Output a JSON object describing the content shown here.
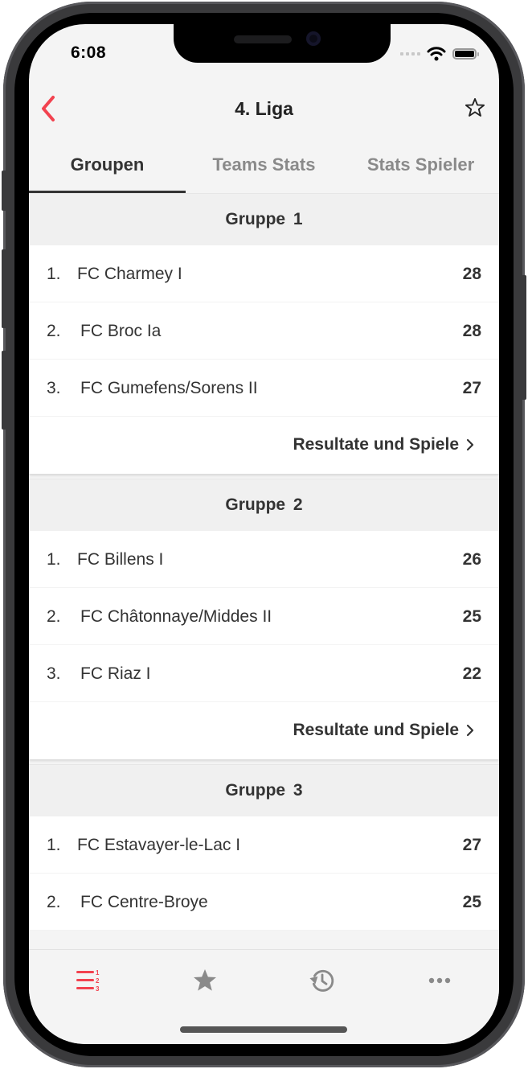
{
  "status_bar": {
    "time": "6:08"
  },
  "nav": {
    "title": "4. Liga",
    "back_icon": "chevron-left-icon",
    "favorite_icon": "star-outline-icon"
  },
  "tabs": [
    {
      "label": "Groupen",
      "active": true
    },
    {
      "label": "Teams Stats",
      "active": false
    },
    {
      "label": "Stats Spieler",
      "active": false
    }
  ],
  "groups": [
    {
      "title": "Gruppe  1",
      "rows": [
        {
          "rank": "1.",
          "team": "FC Charmey I",
          "points": "28"
        },
        {
          "rank": "2.",
          "team": "FC Broc Ia",
          "points": "28"
        },
        {
          "rank": "3.",
          "team": "FC Gumefens/Sorens II",
          "points": "27"
        }
      ],
      "results_link": "Resultate und Spiele"
    },
    {
      "title": "Gruppe  2",
      "rows": [
        {
          "rank": "1.",
          "team": "FC Billens I",
          "points": "26"
        },
        {
          "rank": "2.",
          "team": "FC Châtonnaye/Middes II",
          "points": "25"
        },
        {
          "rank": "3.",
          "team": "FC Riaz I",
          "points": "22"
        }
      ],
      "results_link": "Resultate und Spiele"
    },
    {
      "title": "Gruppe  3",
      "rows": [
        {
          "rank": "1.",
          "team": "FC Estavayer-le-Lac I",
          "points": "27"
        },
        {
          "rank": "2.",
          "team": "FC Centre-Broye",
          "points": "25"
        }
      ]
    }
  ],
  "tabbar": [
    {
      "icon": "ranking-list-icon",
      "active": true
    },
    {
      "icon": "star-icon",
      "active": false
    },
    {
      "icon": "history-icon",
      "active": false
    },
    {
      "icon": "more-icon",
      "active": false
    }
  ],
  "colors": {
    "accent": "#f2424f",
    "text": "#333333",
    "inactive": "#8a8a8a",
    "header_bg": "#f0f0f0"
  }
}
